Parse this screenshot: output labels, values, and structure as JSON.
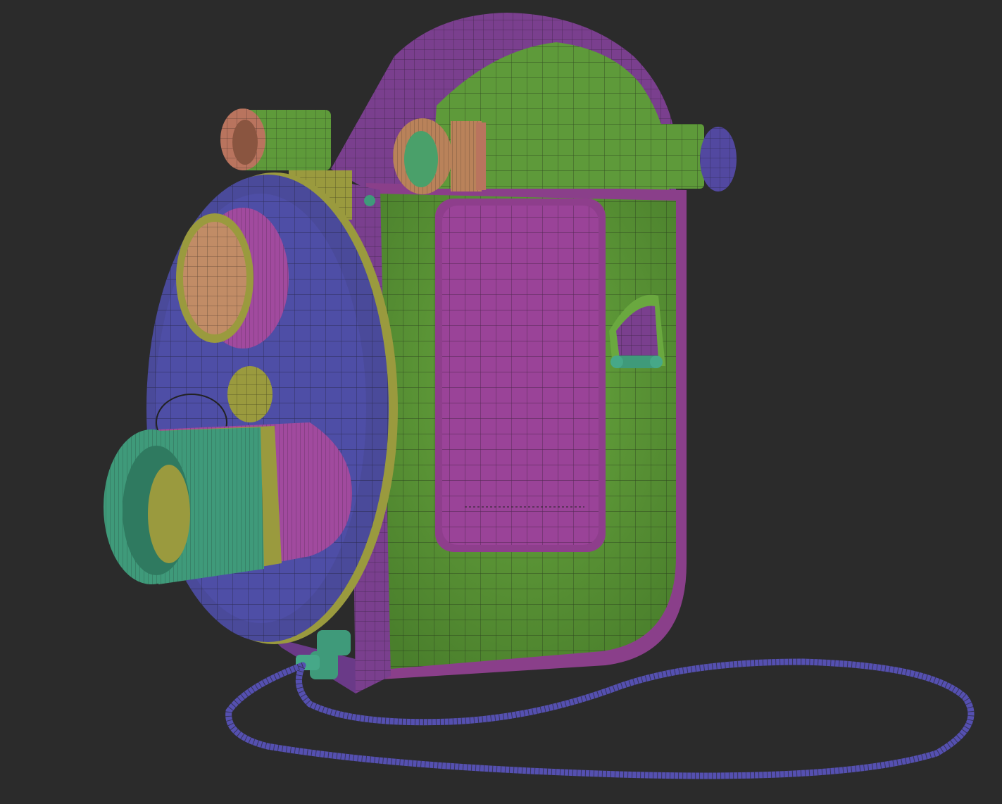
{
  "scene": {
    "subject": "camera-model-polygroups-wireframe",
    "colors": {
      "background": "#2b2b2b",
      "purple": "#7a3f8e",
      "magenta": "#a14a9e",
      "green": "#5e9a3a",
      "indigo": "#4a4a9a",
      "olive": "#9a9a3e",
      "teal": "#3f9a7a",
      "orange": "#b9825a",
      "salmon": "#b9745e",
      "wire": "#1a1a1a"
    }
  }
}
